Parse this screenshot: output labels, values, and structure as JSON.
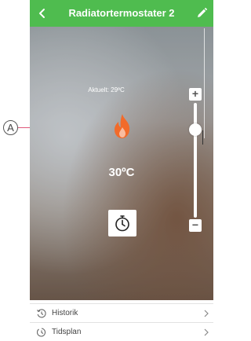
{
  "annotation": {
    "letter": "A"
  },
  "header": {
    "title": "Radiatortermostater 2",
    "back_icon": "chevron-left-icon",
    "edit_icon": "pencil-icon",
    "color": "#4fbc4f"
  },
  "thermostat": {
    "current_label": "Aktuelt: 29ºC",
    "setpoint": "30ºC",
    "flame_icon": "flame-icon",
    "flame_color": "#f26b2a",
    "timer_icon": "timer-icon",
    "slider": {
      "plus_label": "+",
      "minus_label": "−",
      "level": 0.8
    }
  },
  "menu": {
    "items": [
      {
        "label": "Historik",
        "icon": "history-icon"
      },
      {
        "label": "Tidsplan",
        "icon": "schedule-icon"
      }
    ]
  }
}
